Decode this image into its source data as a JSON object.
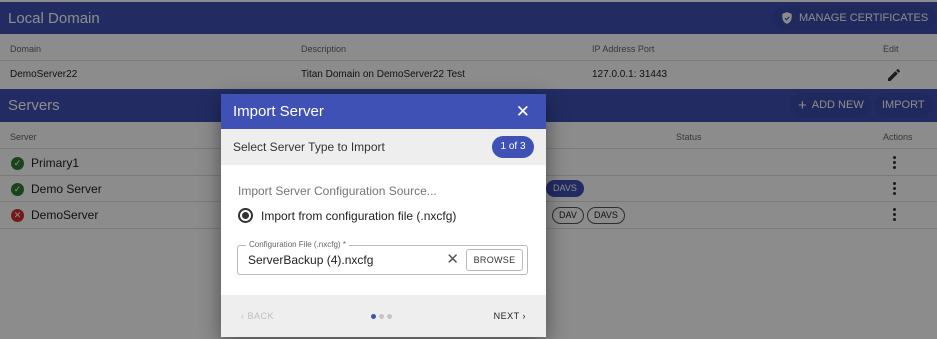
{
  "local_domain": {
    "title": "Local Domain",
    "manage_certificates_label": "MANAGE CERTIFICATES",
    "headers": {
      "domain": "Domain",
      "description": "Description",
      "ip_port": "IP Address Port",
      "edit": "Edit"
    },
    "row": {
      "domain": "DemoServer22",
      "description": "Titan Domain on DemoServer22 Test",
      "ip_port": "127.0.0.1: 31443"
    }
  },
  "servers": {
    "title": "Servers",
    "add_new_label": "ADD NEW",
    "import_label": "IMPORT",
    "headers": {
      "server": "Server",
      "status": "Status",
      "actions": "Actions"
    },
    "rows": [
      {
        "name": "Primary1",
        "state": "ok",
        "chips": []
      },
      {
        "name": "Demo Server",
        "state": "ok",
        "chips": [
          "DAVS"
        ]
      },
      {
        "name": "DemoServer",
        "state": "error",
        "chips": [
          "DAV",
          "DAVS"
        ]
      }
    ]
  },
  "dialog": {
    "title": "Import Server",
    "subtitle": "Select Server Type to Import",
    "step": "1 of 3",
    "source_label": "Import Server Configuration Source...",
    "radio_label": "Import from configuration file (.nxcfg)",
    "field_label": "Configuration File (.nxcfg) *",
    "field_value": "ServerBackup (4).nxcfg",
    "browse_label": "BROWSE",
    "back_label": "BACK",
    "next_label": "NEXT",
    "steps_total": 3,
    "steps_active": 1
  },
  "colors": {
    "primary": "#3f51b5",
    "ok": "#2e7d32",
    "error": "#d32f2f"
  }
}
